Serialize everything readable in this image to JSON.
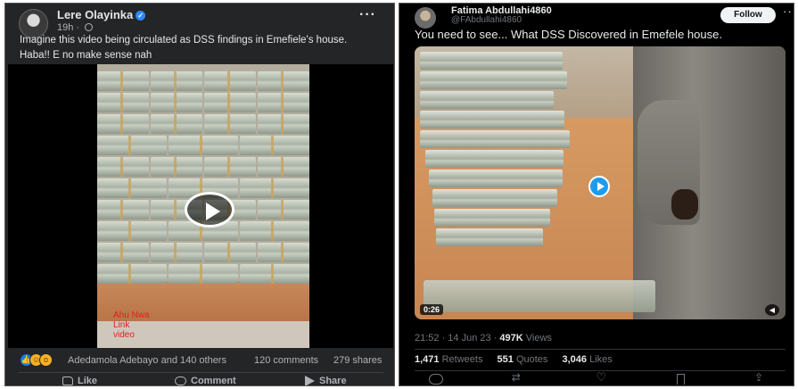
{
  "facebook": {
    "author": "Lere Olayinka",
    "timestamp": "19h",
    "caption_line1": "Imagine this video being circulated as DSS findings in Emefiele's house.",
    "caption_line2": "Haba!! E no make sense nah",
    "watermark": "Ahu Nwa\nLink\nvideo",
    "reactions_names": "Adedamola Adebayo and 140 others",
    "comments_count": "120 comments",
    "shares_count": "279 shares",
    "actions": {
      "like": "Like",
      "comment": "Comment",
      "share": "Share"
    },
    "icons": [
      "verified-badge-icon",
      "globe-icon",
      "more-icon",
      "play-icon",
      "like-reaction-icon",
      "laugh-reaction-icon",
      "wow-reaction-icon",
      "thumbs-up-icon",
      "comment-icon",
      "share-icon"
    ]
  },
  "twitter": {
    "display_name": "Fatima Abdullahi4860",
    "handle": "@FAbdullahi4860",
    "follow_label": "Follow",
    "tweet_text": "You need to see... What DSS Discovered in Emefele house.",
    "video_duration": "0:26",
    "time": "21:52 · 14 Jun 23 ·",
    "views_count": "497K",
    "views_label": "Views",
    "retweets_count": "1,471",
    "retweets_label": "Retweets",
    "quotes_count": "551",
    "quotes_label": "Quotes",
    "likes_count": "3,046",
    "likes_label": "Likes",
    "icons": [
      "reply-icon",
      "retweet-icon",
      "like-icon",
      "bookmark-icon",
      "share-icon",
      "play-icon",
      "volume-icon",
      "more-icon"
    ]
  },
  "colors": {
    "fb_bg": "#242526",
    "fb_text": "#e4e6eb",
    "fb_secondary": "#b0b3b8",
    "fb_blue": "#1877f2",
    "tw_bg": "#000000",
    "tw_text": "#e7e9ea",
    "tw_secondary": "#71767b",
    "tw_blue": "#1d9bf0"
  }
}
